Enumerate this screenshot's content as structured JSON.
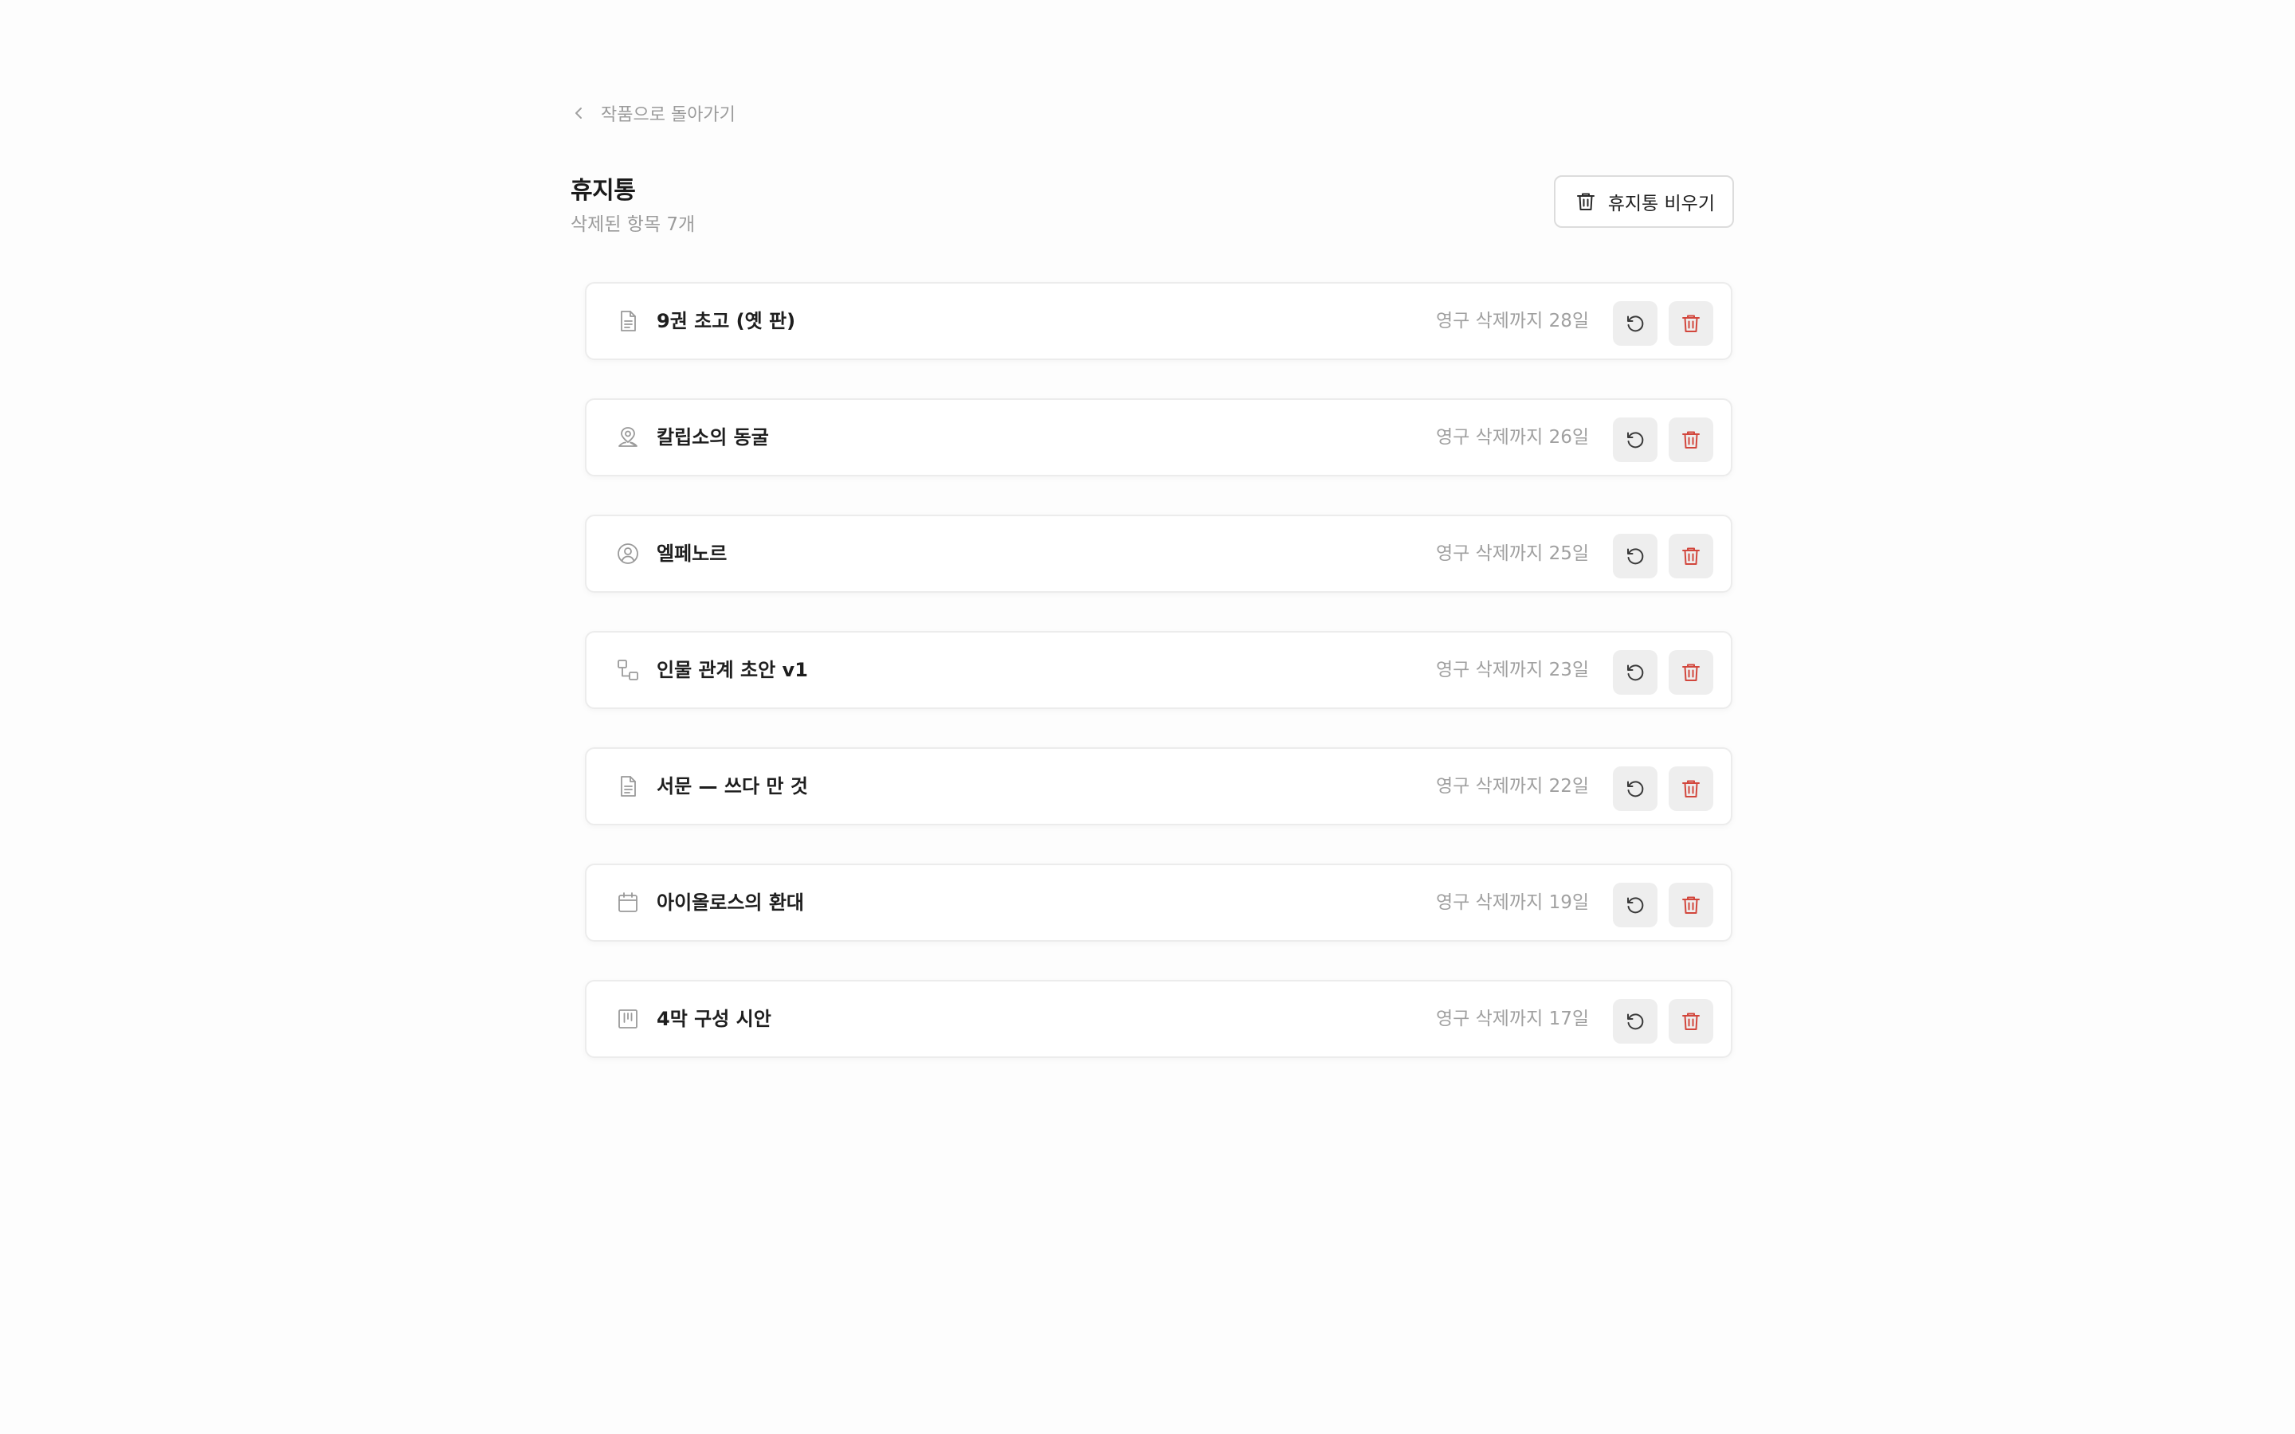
{
  "nav": {
    "back_label": "작품으로 돌아가기"
  },
  "header": {
    "title": "휴지통",
    "subtitle": "삭제된 항목 7개",
    "empty_button_label": "휴지통 비우기"
  },
  "colors": {
    "danger": "#d2463c",
    "muted_text": "#9b9b9b",
    "icon_gray": "#9a9a9a"
  },
  "items": [
    {
      "icon": "document-icon",
      "name": "9권 초고 (옛 판)",
      "remaining": "영구 삭제까지 28일"
    },
    {
      "icon": "location-pin-icon",
      "name": "칼립소의 동굴",
      "remaining": "영구 삭제까지 26일"
    },
    {
      "icon": "user-circle-icon",
      "name": "엘페노르",
      "remaining": "영구 삭제까지 25일"
    },
    {
      "icon": "relationship-diagram-icon",
      "name": "인물 관계 초안 v1",
      "remaining": "영구 삭제까지 23일"
    },
    {
      "icon": "document-icon",
      "name": "서문 — 쓰다 만 것",
      "remaining": "영구 삭제까지 22일"
    },
    {
      "icon": "calendar-icon",
      "name": "아이올로스의 환대",
      "remaining": "영구 삭제까지 19일"
    },
    {
      "icon": "board-columns-icon",
      "name": "4막 구성 시안",
      "remaining": "영구 삭제까지 17일"
    }
  ]
}
